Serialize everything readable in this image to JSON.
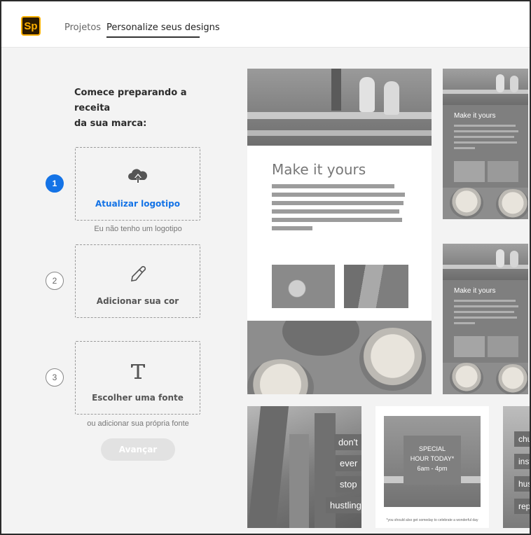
{
  "app": {
    "logo_text": "Sp",
    "accent": "#1473e6"
  },
  "nav": {
    "tabs": [
      {
        "label": "Projetos"
      },
      {
        "label": "Personalize seus designs"
      }
    ]
  },
  "intro": {
    "line1": "Comece preparando a receita",
    "line2": "da sua marca:"
  },
  "steps": [
    {
      "number": "1",
      "label": "Atualizar logotipo",
      "icon": "cloud-upload-icon",
      "sub": "Eu não tenho um logotipo"
    },
    {
      "number": "2",
      "label": "Adicionar sua cor",
      "icon": "eyedropper-icon"
    },
    {
      "number": "3",
      "label": "Escolher uma fonte",
      "icon": "text-T-icon",
      "sub": "ou adicionar sua própria fonte"
    }
  ],
  "next_button": "Avançar",
  "designs": {
    "heading_big": "Make it yours",
    "heading_small_1": "Make it yours",
    "heading_small_2": "Make it yours",
    "hustle": [
      "don't",
      "ever",
      "stop",
      "hustling"
    ],
    "special": [
      "SPECIAL",
      "HOUR TODAY*",
      "6am - 4pm"
    ],
    "footnote": "*you should also get someday to celebrate a wonderful day",
    "partial": [
      "chu",
      "inst",
      "hus",
      "rep"
    ]
  }
}
